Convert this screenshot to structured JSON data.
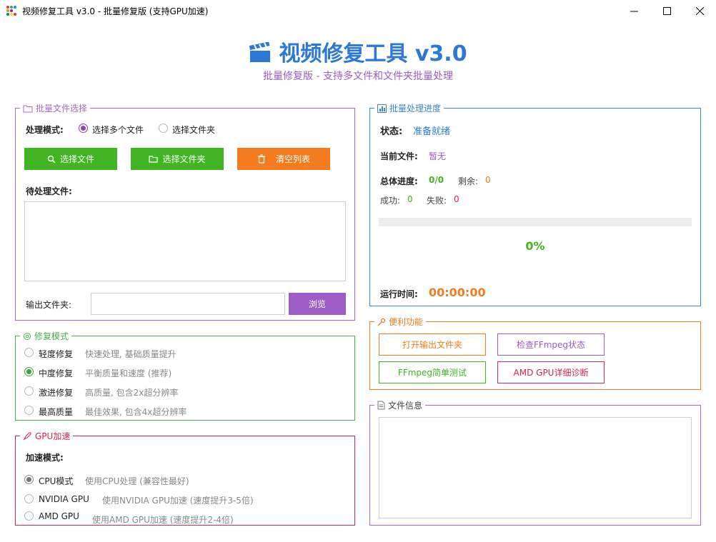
{
  "window": {
    "title": "视频修复工具 v3.0 - 批量修复版 (支持GPU加速)",
    "minimize_glyph": "─",
    "maximize_glyph": "☐",
    "close_glyph": "✕"
  },
  "header": {
    "title": "视频修复工具 v3.0",
    "subtitle": "批量修复版 - 支持多文件和文件夹批量处理",
    "icon": "clapperboard-icon"
  },
  "file_section": {
    "legend": "批量文件选择",
    "mode_label": "处理模式:",
    "mode_options": [
      "选择多个文件",
      "选择文件夹"
    ],
    "mode_selected": "选择多个文件",
    "select_files_button": "选择文件",
    "select_folder_button": "选择文件夹",
    "clear_list_button": "清空列表",
    "pending_label": "待处理文件:",
    "pending_files": [],
    "output_label": "输出文件夹:",
    "output_value": "",
    "browse_button": "浏览"
  },
  "progress_section": {
    "legend": "批量处理进度",
    "status_label": "状态:",
    "status_value": "准备就绪",
    "current_file_label": "当前文件:",
    "current_file_value": "暂无",
    "total_label": "总体进度:",
    "total_value": "0/0",
    "remaining_label": "剩余:",
    "remaining_value": "0",
    "success_label": "成功:",
    "success_value": "0",
    "failed_label": "失败:",
    "failed_value": "0",
    "progress_fraction": 0,
    "percent_text": "0%",
    "runtime_label": "运行时间:",
    "runtime_value": "00:00:00"
  },
  "repair_mode": {
    "legend": "修复模式",
    "selected": "中度修复",
    "options": [
      {
        "label": "轻度修复",
        "desc": "快速处理, 基础质量提升"
      },
      {
        "label": "中度修复",
        "desc": "平衡质量和速度 (推荐)"
      },
      {
        "label": "激进修复",
        "desc": "高质量, 包含2x超分辨率"
      },
      {
        "label": "最高质量",
        "desc": "最佳效果, 包含4x超分辨率"
      }
    ]
  },
  "gpu": {
    "legend": "GPU加速",
    "accel_label": "加速模式:",
    "selected": "CPU模式",
    "options": [
      {
        "label": "CPU模式",
        "desc": "使用CPU处理 (兼容性最好)"
      },
      {
        "label": "NVIDIA GPU",
        "desc": "使用NVIDIA GPU加速 (速度提升3-5倍)"
      },
      {
        "label": "AMD GPU",
        "desc": "使用AMD GPU加速 (速度提升2-4倍)"
      }
    ]
  },
  "tools": {
    "legend": "便利功能",
    "open_output": "打开输出文件夹",
    "check_ffmpeg": "检查FFmpeg状态",
    "ffmpeg_test": "FFmpeg简单测试",
    "amd_diag": "AMD GPU详细诊断"
  },
  "file_info": {
    "legend": "文件信息",
    "content": ""
  },
  "colors": {
    "primary_blue": "#2b78d6",
    "purple": "#9d5bc6",
    "green": "#41b523",
    "orange": "#f47c1e",
    "red": "#d6264f"
  }
}
